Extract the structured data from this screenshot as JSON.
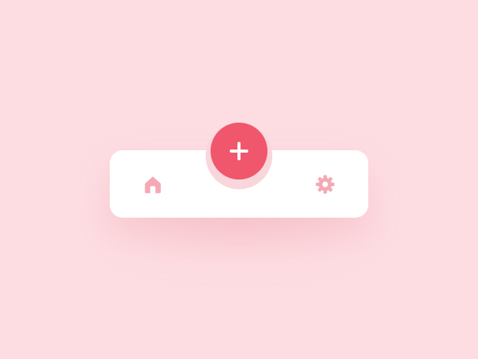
{
  "tabbar": {
    "items": [
      {
        "id": "home",
        "icon": "home-icon"
      },
      {
        "id": "add",
        "icon": "plus-icon"
      },
      {
        "id": "settings",
        "icon": "gear-icon"
      }
    ]
  },
  "colors": {
    "background": "#fddde2",
    "bar": "#ffffff",
    "fab": "#f0566c",
    "icon": "#f4a9b5",
    "fab_icon": "#ffffff"
  }
}
